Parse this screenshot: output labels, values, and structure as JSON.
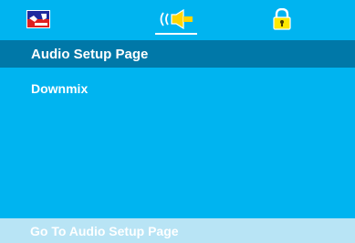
{
  "tabs": [
    {
      "icon": "general-setup-icon"
    },
    {
      "icon": "audio-speaker-icon",
      "selected": true
    },
    {
      "icon": "lock-icon"
    }
  ],
  "header": {
    "title": "Audio Setup Page"
  },
  "menu": {
    "items": [
      {
        "label": "Downmix"
      }
    ]
  },
  "status": {
    "text": "Go To Audio Setup Page"
  },
  "colors": {
    "background": "#00b4f0",
    "header": "#0078a8",
    "status_bar": "#b8e4f5",
    "text": "#ffffff",
    "lock_yellow": "#ffe800",
    "speaker_yellow": "#ffd500"
  }
}
